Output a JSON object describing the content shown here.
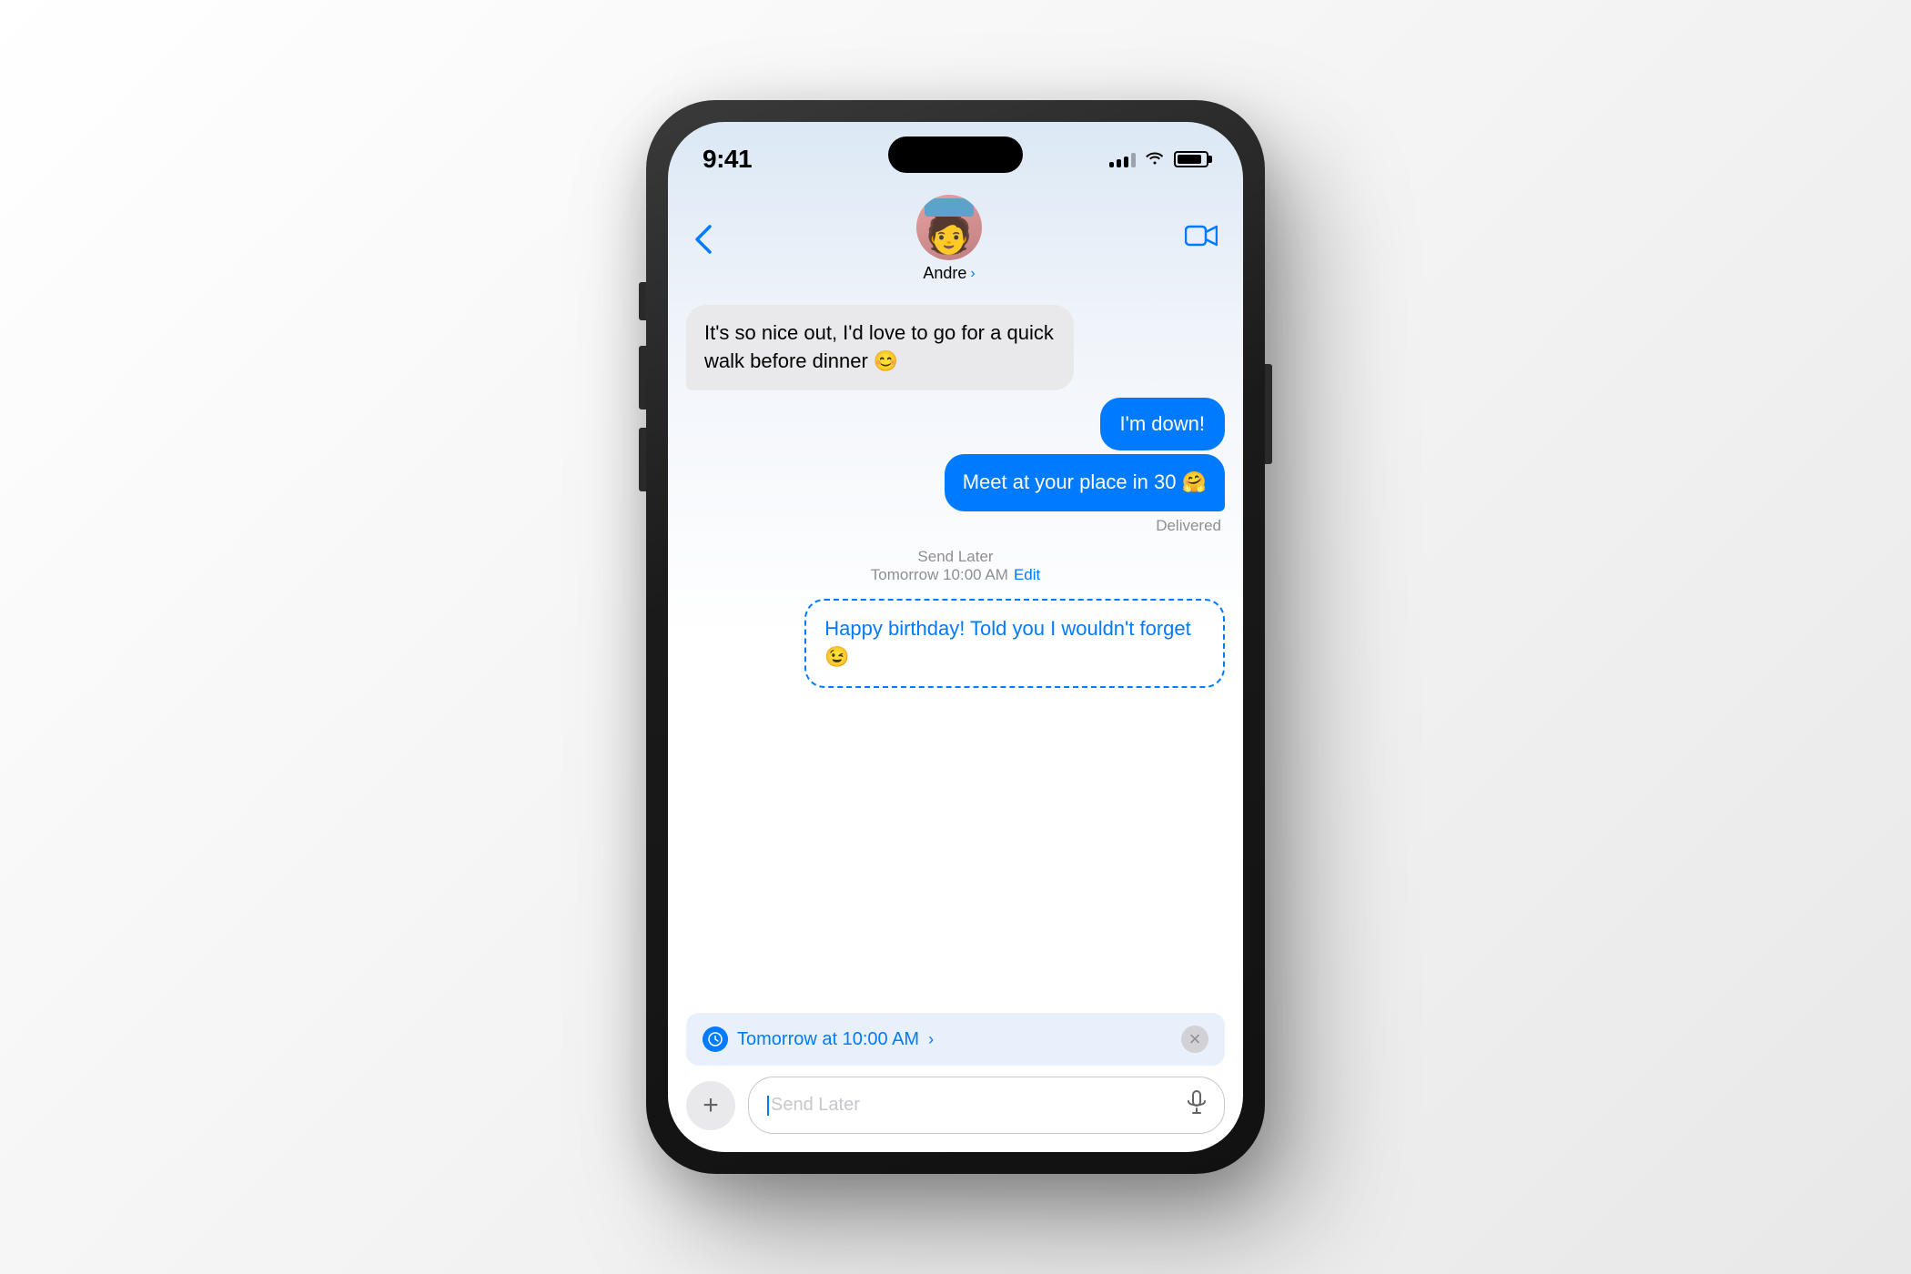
{
  "scene": {
    "background": "#efefef"
  },
  "status_bar": {
    "time": "9:41",
    "signal_label": "Signal",
    "wifi_label": "WiFi",
    "battery_label": "Battery"
  },
  "nav": {
    "back_label": "Back",
    "contact_name": "Andre",
    "chevron": "›",
    "video_label": "Video Call"
  },
  "messages": [
    {
      "id": "msg1",
      "type": "received",
      "text": "It's so nice out, I'd love to go for a quick walk before dinner 😊"
    },
    {
      "id": "msg2",
      "type": "sent",
      "text": "I'm down!"
    },
    {
      "id": "msg3",
      "type": "sent",
      "text": "Meet at your place in 30 🤗"
    },
    {
      "id": "msg4",
      "type": "status",
      "text": "Delivered"
    },
    {
      "id": "msg5",
      "type": "send-later-info",
      "label": "Send Later",
      "time": "Tomorrow 10:00 AM",
      "edit": "Edit"
    },
    {
      "id": "msg6",
      "type": "scheduled",
      "text": "Happy birthday! Told you I wouldn't forget 😉"
    }
  ],
  "input": {
    "placeholder": "Send Later",
    "plus_label": "Add attachment",
    "mic_label": "Voice message"
  },
  "send_later_pill": {
    "text": "Tomorrow at 10:00 AM",
    "chevron": "›",
    "close_label": "×"
  }
}
